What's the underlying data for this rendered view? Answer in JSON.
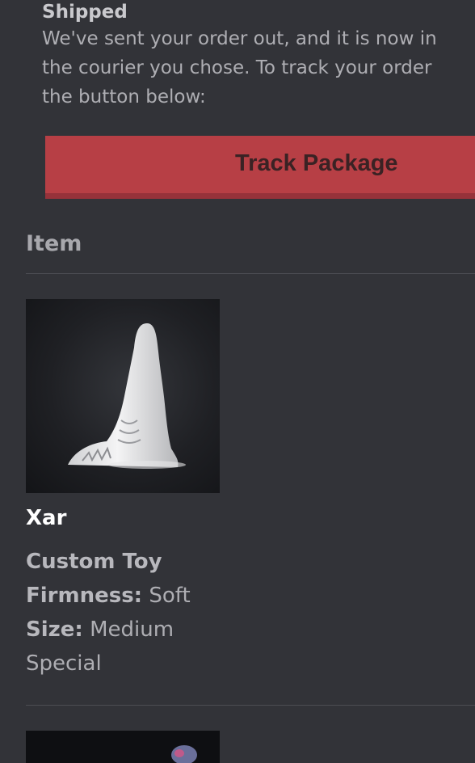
{
  "status": {
    "title": "Shipped",
    "lines": [
      "We've sent your order out, and it is now in",
      "the courier you chose. To track your order",
      "the button below:"
    ]
  },
  "track_button": {
    "label": "Track Package"
  },
  "items_section": {
    "heading": "Item",
    "items": [
      {
        "name": "Xar",
        "type": "Custom Toy",
        "firmness_label": "Firmness:",
        "firmness_value": "Soft",
        "size_label": "Size:",
        "size_value": "Medium",
        "note": "Special"
      }
    ]
  },
  "colors": {
    "background": "#323338",
    "accent": "#b73f45"
  }
}
